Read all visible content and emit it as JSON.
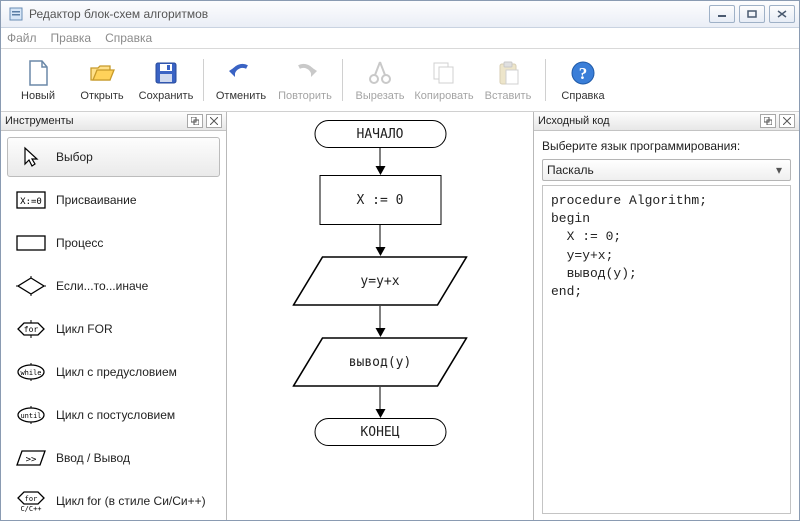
{
  "window": {
    "title": "Редактор блок-схем алгоритмов"
  },
  "menu": {
    "file": "Файл",
    "edit": "Правка",
    "help": "Справка"
  },
  "toolbar": {
    "new": "Новый",
    "open": "Открыть",
    "save": "Сохранить",
    "undo": "Отменить",
    "redo": "Повторить",
    "cut": "Вырезать",
    "copy": "Копировать",
    "paste": "Вставить",
    "help": "Справка"
  },
  "panels": {
    "tools_title": "Инструменты",
    "code_title": "Исходный код"
  },
  "tools": {
    "select": "Выбор",
    "assign": "Присваивание",
    "process": "Процесс",
    "ifelse": "Если...то...иначе",
    "for": "Цикл FOR",
    "while": "Цикл с предусловием",
    "until": "Цикл с постусловием",
    "io": "Ввод / Вывод",
    "cfor": "Цикл for (в стиле Си/Си++)"
  },
  "flow": {
    "start": "НАЧАЛО",
    "assign": "X := 0",
    "expr": "y=y+x",
    "output": "вывод(y)",
    "end": "КОНЕЦ"
  },
  "code_panel": {
    "choose_label": "Выберите язык программирования:",
    "language": "Паскаль",
    "code": "procedure Algorithm;\nbegin\n  X := 0;\n  y=y+x;\n  вывод(y);\nend;"
  }
}
